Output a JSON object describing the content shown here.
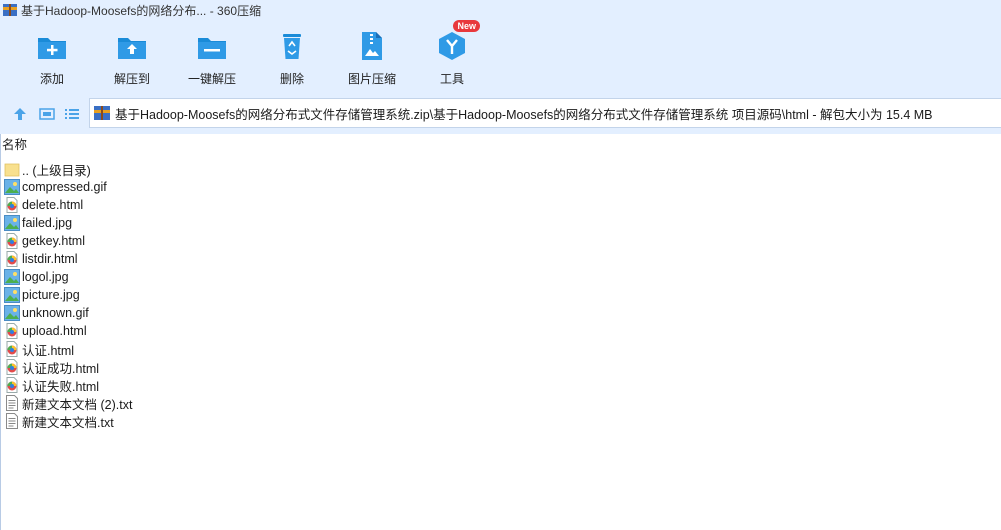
{
  "window": {
    "title": "基于Hadoop-Moosefs的网络分布... - 360压缩"
  },
  "toolbar": {
    "items": [
      {
        "label": "添加",
        "icon": "add-box-icon"
      },
      {
        "label": "解压到",
        "icon": "extract-to-icon"
      },
      {
        "label": "一键解压",
        "icon": "one-click-extract-icon"
      },
      {
        "label": "删除",
        "icon": "recycle-delete-icon"
      },
      {
        "label": "图片压缩",
        "icon": "image-compress-icon"
      },
      {
        "label": "工具",
        "icon": "tools-icon",
        "badge": "New"
      }
    ]
  },
  "address": {
    "path": "基于Hadoop-Moosefs的网络分布式文件存储管理系统.zip\\基于Hadoop-Moosefs的网络分布式文件存储管理系统 项目源码\\html - 解包大小为 15.4 MB"
  },
  "list": {
    "column_name": "名称",
    "rows": [
      {
        "name": ".. (上级目录)",
        "icon": "folder-icon"
      },
      {
        "name": "compressed.gif",
        "icon": "image-file-icon"
      },
      {
        "name": "delete.html",
        "icon": "html-file-icon"
      },
      {
        "name": "failed.jpg",
        "icon": "image-file-icon"
      },
      {
        "name": "getkey.html",
        "icon": "html-file-icon"
      },
      {
        "name": "listdir.html",
        "icon": "html-file-icon"
      },
      {
        "name": "logol.jpg",
        "icon": "image-file-icon"
      },
      {
        "name": "picture.jpg",
        "icon": "image-file-icon"
      },
      {
        "name": "unknown.gif",
        "icon": "image-file-icon"
      },
      {
        "name": "upload.html",
        "icon": "html-file-icon"
      },
      {
        "name": "认证.html",
        "icon": "html-file-icon"
      },
      {
        "name": "认证成功.html",
        "icon": "html-file-icon"
      },
      {
        "name": "认证失败.html",
        "icon": "html-file-icon"
      },
      {
        "name": "新建文本文档 (2).txt",
        "icon": "text-file-icon"
      },
      {
        "name": "新建文本文档.txt",
        "icon": "text-file-icon"
      }
    ]
  },
  "colors": {
    "chrome_bg": "#e3efff",
    "accent": "#1a8bd8",
    "badge": "#e8383d"
  }
}
